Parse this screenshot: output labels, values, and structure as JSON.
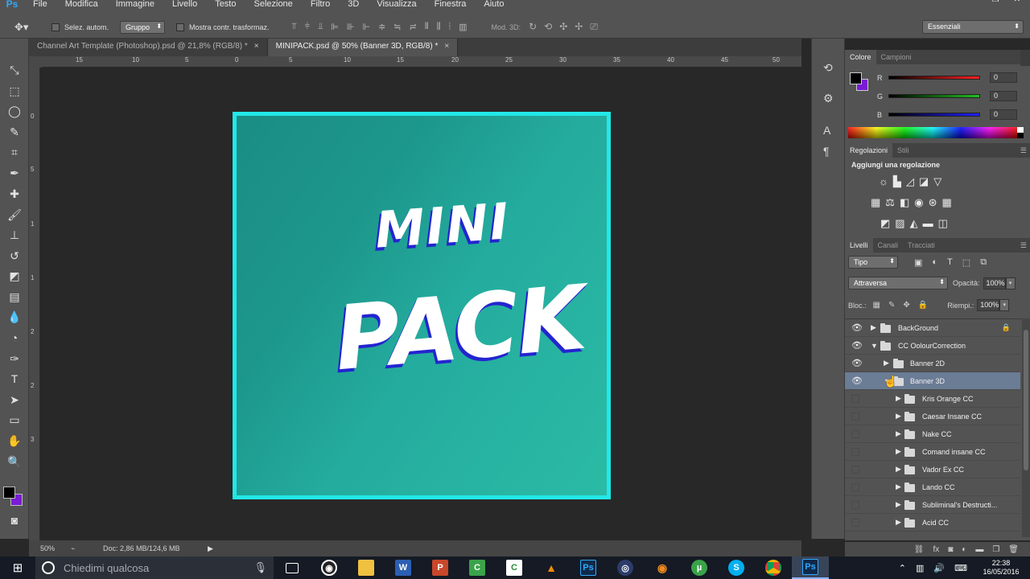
{
  "app": {
    "logo": "Ps"
  },
  "menu": [
    "File",
    "Modifica",
    "Immagine",
    "Livello",
    "Testo",
    "Selezione",
    "Filtro",
    "3D",
    "Visualizza",
    "Finestra",
    "Aiuto"
  ],
  "window_controls": [
    "–",
    "❐",
    "✕"
  ],
  "options": {
    "auto_select_label": "Selez. autom.",
    "group_value": "Gruppo",
    "transform_label": "Mostra contr. trasformaz.",
    "mode3d_label": "Mod. 3D:",
    "workspace": "Essenziali"
  },
  "tabs": [
    {
      "label": "Channel Art Template (Photoshop).psd @ 21,8% (RGB/8) *",
      "active": false
    },
    {
      "label": "MINIPACK.psd @ 50% (Banner 3D, RGB/8) *",
      "active": true
    }
  ],
  "ruler": {
    "h": [
      "15",
      "10",
      "5",
      "0",
      "5",
      "10",
      "15",
      "20",
      "25",
      "30",
      "35",
      "40",
      "45",
      "50"
    ],
    "v": [
      "0",
      "5",
      "1",
      "1",
      "2",
      "2",
      "3"
    ]
  },
  "artwork": {
    "line1": "MINI",
    "line2": "PACK",
    "border_color": "#22e8e8",
    "text_shadow_color": "#2424d0"
  },
  "status": {
    "zoom": "50%",
    "doc": "Doc: 2,86 MB/124,6 MB"
  },
  "color_panel": {
    "tabs": [
      "Colore",
      "Campioni"
    ],
    "channels": [
      {
        "letter": "R",
        "value": "0",
        "color": "#ff2020"
      },
      {
        "letter": "G",
        "value": "0",
        "color": "#20c020"
      },
      {
        "letter": "B",
        "value": "0",
        "color": "#2020ff"
      }
    ],
    "foreground": "#000000",
    "background": "#7a1bd6"
  },
  "adjustments": {
    "tabs": [
      "Regolazioni",
      "Stili"
    ],
    "title": "Aggiungi una regolazione"
  },
  "layers_panel": {
    "tabs": [
      "Livelli",
      "Canali",
      "Tracciati"
    ],
    "kind": "Tipo",
    "blend_mode": "Attraversa",
    "opacity_label": "Opacità:",
    "opacity": "100%",
    "lock_label": "Bloc.:",
    "fill_label": "Riempi.:",
    "fill": "100%",
    "layers": [
      {
        "name": "BackGround",
        "visible": true,
        "expanded": false,
        "locked": true
      },
      {
        "name": "CC OolourCorrection",
        "visible": true,
        "expanded": true
      },
      {
        "name": "Banner 2D",
        "visible": true,
        "expanded": false
      },
      {
        "name": "Banner 3D",
        "visible": true,
        "expanded": true,
        "selected": true
      },
      {
        "name": "Kris Orange CC",
        "visible": false
      },
      {
        "name": "Caesar Insane CC",
        "visible": false
      },
      {
        "name": "Nake CC",
        "visible": false
      },
      {
        "name": "Comand insane CC",
        "visible": false
      },
      {
        "name": "Vador Ex CC",
        "visible": false
      },
      {
        "name": "Lando CC",
        "visible": false
      },
      {
        "name": "Subliminal's Destructi...",
        "visible": false
      },
      {
        "name": "Acid CC",
        "visible": false
      }
    ]
  },
  "taskbar": {
    "search_placeholder": "Chiedimi qualcosa",
    "time": "22:38",
    "date": "16/05/2016"
  }
}
